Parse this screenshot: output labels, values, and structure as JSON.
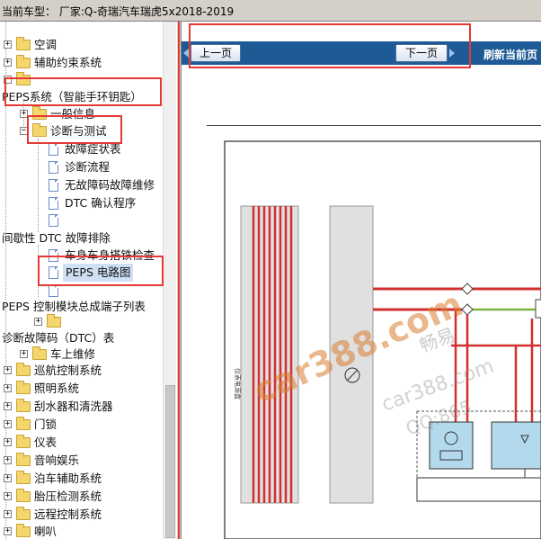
{
  "window": {
    "title": "当前车型： 厂家:Q-奇瑞汽车瑞虎5x2018-2019"
  },
  "tree": {
    "items": [
      {
        "label": "空调",
        "kind": "folder"
      },
      {
        "label": "辅助约束系统",
        "kind": "folder"
      },
      {
        "label": "",
        "kind": "folder"
      },
      {
        "label": "PEPS系统（智能手环钥匙）",
        "kind": "text"
      },
      {
        "label": "一般信息",
        "kind": "folder"
      },
      {
        "label": "诊断与测试",
        "kind": "folder"
      },
      {
        "label": "故障症状表",
        "kind": "doc"
      },
      {
        "label": "诊断流程",
        "kind": "doc"
      },
      {
        "label": "无故障码故障维修",
        "kind": "doc"
      },
      {
        "label": "DTC 确认程序",
        "kind": "doc"
      },
      {
        "label": "",
        "kind": "doc"
      },
      {
        "label": "间歇性 DTC 故障排除",
        "kind": "text"
      },
      {
        "label": "车身车身搭铁检查",
        "kind": "doc"
      },
      {
        "label": "PEPS 电路图",
        "kind": "doc"
      },
      {
        "label": "",
        "kind": "doc"
      },
      {
        "label": "PEPS 控制模块总成端子列表",
        "kind": "text"
      },
      {
        "label": "",
        "kind": "folder"
      },
      {
        "label": "诊断故障码（DTC）表",
        "kind": "text"
      },
      {
        "label": "车上维修",
        "kind": "folder"
      },
      {
        "label": "巡航控制系统",
        "kind": "folder"
      },
      {
        "label": "照明系统",
        "kind": "folder"
      },
      {
        "label": "刮水器和清洗器",
        "kind": "folder"
      },
      {
        "label": "门锁",
        "kind": "folder"
      },
      {
        "label": "仪表",
        "kind": "folder"
      },
      {
        "label": "音响娱乐",
        "kind": "folder"
      },
      {
        "label": "泊车辅助系统",
        "kind": "folder"
      },
      {
        "label": "胎压检测系统",
        "kind": "folder"
      },
      {
        "label": "远程控制系统",
        "kind": "folder"
      },
      {
        "label": "喇叭",
        "kind": "folder"
      }
    ]
  },
  "viewer": {
    "prev_label": "上一页",
    "next_label": "下一页",
    "refresh_label": "刷新当前页",
    "accent_color": "#1e5b96"
  },
  "diagram": {
    "left_bar_label": "仪表电源盒",
    "watermarks": [
      "car388.com",
      "畅易",
      "car388.com",
      "QQ:865"
    ],
    "wire_colors": {
      "red": "#d32f2f",
      "green": "#7cb342",
      "blue_fill": "#b3d9ec"
    }
  },
  "highlight_color": "#e53935"
}
